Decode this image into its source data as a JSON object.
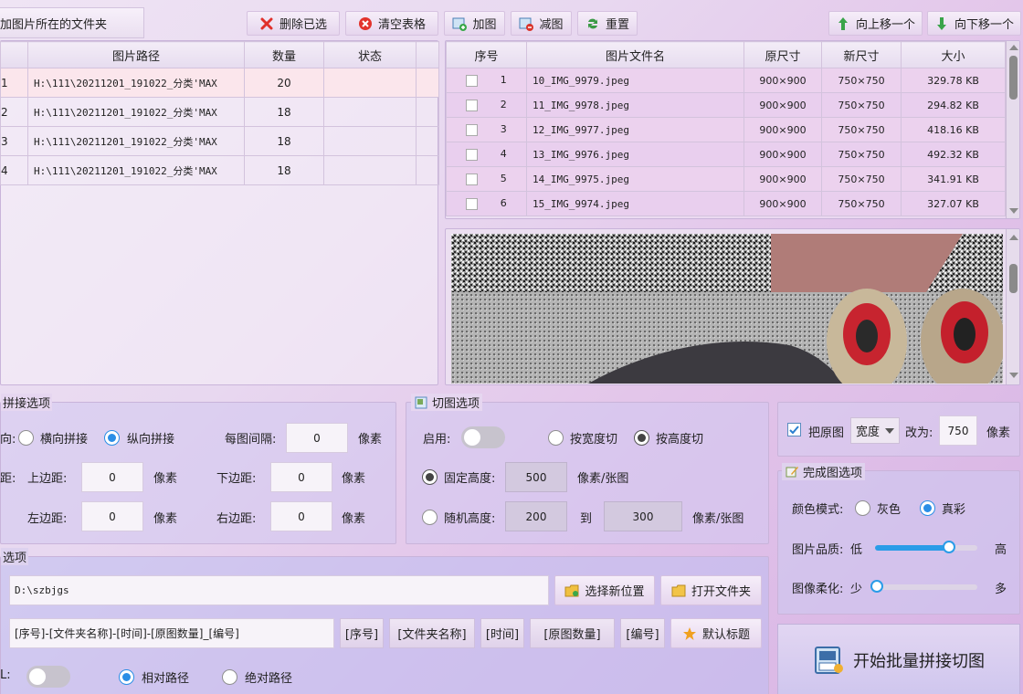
{
  "top": {
    "folder_label": "加图片所在的文件夹",
    "delete_selected": "删除已选",
    "clear_table": "清空表格",
    "add_image": "加图",
    "remove_image": "减图",
    "reset": "重置",
    "move_up": "向上移一个",
    "move_down": "向下移一个"
  },
  "folder_table": {
    "headers": [
      "图片路径",
      "数量",
      "状态"
    ],
    "rows": [
      {
        "idx": "1",
        "path": "H:\\111\\20211201_191022_分类'MAX",
        "count": "20",
        "status": ""
      },
      {
        "idx": "2",
        "path": "H:\\111\\20211201_191022_分类'MAX",
        "count": "18",
        "status": ""
      },
      {
        "idx": "3",
        "path": "H:\\111\\20211201_191022_分类'MAX",
        "count": "18",
        "status": ""
      },
      {
        "idx": "4",
        "path": "H:\\111\\20211201_191022_分类'MAX",
        "count": "18",
        "status": ""
      }
    ]
  },
  "file_table": {
    "headers": [
      "序号",
      "图片文件名",
      "原尺寸",
      "新尺寸",
      "大小"
    ],
    "rows": [
      {
        "no": "1",
        "name": "10_IMG_9979.jpeg",
        "orig": "900×900",
        "new": "750×750",
        "size": "329.78 KB"
      },
      {
        "no": "2",
        "name": "11_IMG_9978.jpeg",
        "orig": "900×900",
        "new": "750×750",
        "size": "294.82 KB"
      },
      {
        "no": "3",
        "name": "12_IMG_9977.jpeg",
        "orig": "900×900",
        "new": "750×750",
        "size": "418.16 KB"
      },
      {
        "no": "4",
        "name": "13_IMG_9976.jpeg",
        "orig": "900×900",
        "new": "750×750",
        "size": "492.32 KB"
      },
      {
        "no": "5",
        "name": "14_IMG_9975.jpeg",
        "orig": "900×900",
        "new": "750×750",
        "size": "341.91 KB"
      },
      {
        "no": "6",
        "name": "15_IMG_9974.jpeg",
        "orig": "900×900",
        "new": "750×750",
        "size": "327.07 KB"
      }
    ]
  },
  "stitch": {
    "title": "拼接选项",
    "direction_label": "向:",
    "horizontal": "横向拼接",
    "vertical": "纵向拼接",
    "gap_label": "每图间隔:",
    "gap_value": "0",
    "px": "像素",
    "margin_label": "距:",
    "top_label": "上边距:",
    "top_value": "0",
    "bottom_label": "下边距:",
    "bottom_value": "0",
    "left_label": "左边距:",
    "left_value": "0",
    "right_label": "右边距:",
    "right_value": "0"
  },
  "cut": {
    "title": "切图选项",
    "enable_label": "启用:",
    "by_width": "按宽度切",
    "by_height": "按高度切",
    "fixed_label": "固定高度:",
    "fixed_value": "500",
    "unit": "像素/张图",
    "random_label": "随机高度:",
    "random_from": "200",
    "to": "到",
    "random_to": "300"
  },
  "resize": {
    "label": "把原图",
    "mode": "宽度",
    "change_to": "改为:",
    "value": "750",
    "px": "像素"
  },
  "finish": {
    "title": "完成图选项",
    "color_label": "颜色模式:",
    "gray": "灰色",
    "true_color": "真彩",
    "quality_label": "图片品质:",
    "low": "低",
    "high": "高",
    "quality_level": 0.72,
    "soften_label": "图像柔化:",
    "less": "少",
    "more": "多",
    "soften_level": 0.0
  },
  "output": {
    "title": "选项",
    "path": "D:\\szbjgs",
    "choose_location": "选择新位置",
    "open_folder": "打开文件夹",
    "pattern": "[序号]-[文件夹名称]-[时间]-[原图数量]_[编号]",
    "tags": [
      "[序号]",
      "[文件夹名称]",
      "[时间]",
      "[原图数量]",
      "[编号]"
    ],
    "default_title": "默认标题",
    "html_label": "L:",
    "relative_path": "相对路径",
    "absolute_path": "绝对路径"
  },
  "start_button": "开始批量拼接切图"
}
